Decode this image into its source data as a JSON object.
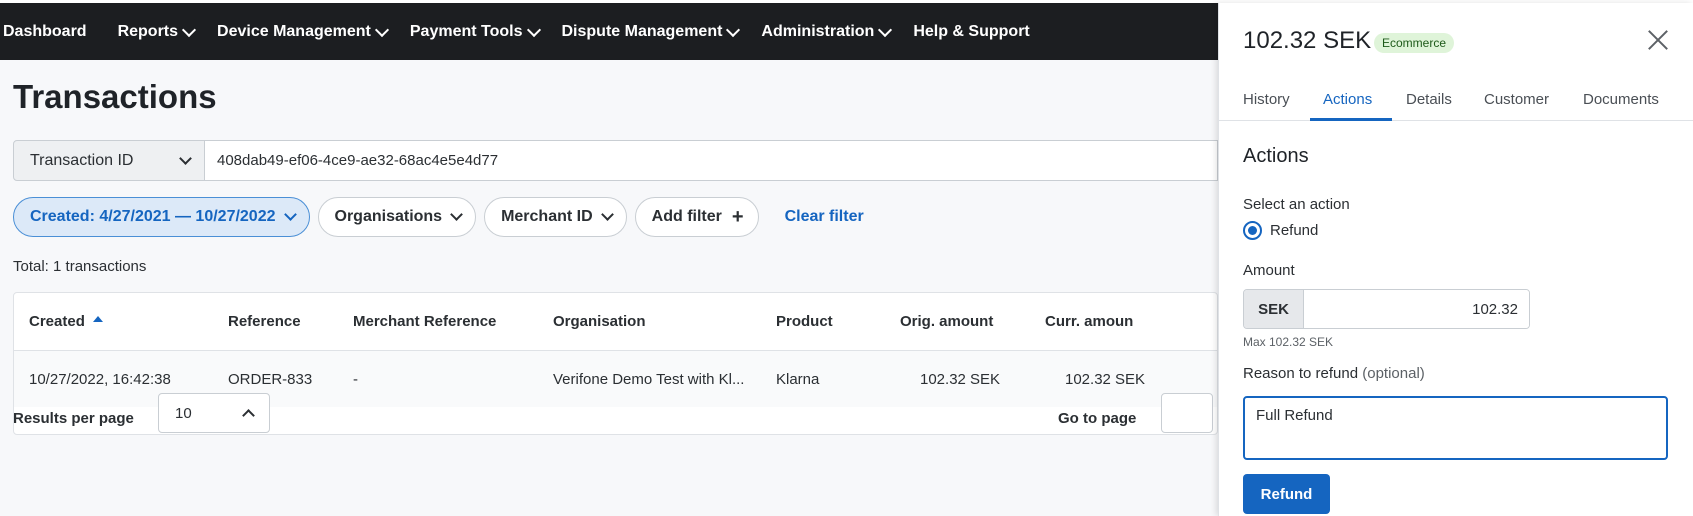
{
  "nav": {
    "items": [
      {
        "label": "Dashboard"
      },
      {
        "label": "Reports"
      },
      {
        "label": "Device Management"
      },
      {
        "label": "Payment Tools"
      },
      {
        "label": "Dispute Management"
      },
      {
        "label": "Administration"
      },
      {
        "label": "Help & Support"
      }
    ]
  },
  "page": {
    "title": "Transactions",
    "search_type": "Transaction ID",
    "search_value": "408dab49-ef06-4ce9-ae32-68ac4e5e4d77",
    "filters": {
      "created": "Created: 4/27/2021 — 10/27/2022",
      "organisations": "Organisations",
      "merchant_id": "Merchant ID",
      "add_filter": "Add filter",
      "clear_filter": "Clear filter"
    },
    "total": "Total: 1 transactions"
  },
  "table": {
    "columns": [
      "Created",
      "Reference",
      "Merchant Reference",
      "Organisation",
      "Product",
      "Orig. amount",
      "Curr. amoun"
    ],
    "rows": [
      [
        "10/27/2022, 16:42:38",
        "ORDER-833",
        "-",
        "Verifone Demo Test with Kl...",
        "Klarna",
        "102.32 SEK",
        "102.32 SEK"
      ]
    ]
  },
  "pagination": {
    "results_label": "Results per page",
    "per_page": "10",
    "goto_label": "Go to page",
    "goto_value": ""
  },
  "panel": {
    "amount": "102.32 SEK",
    "badge": "Ecommerce",
    "tabs": [
      "History",
      "Actions",
      "Details",
      "Customer",
      "Documents"
    ],
    "active_tab": "Actions",
    "section_title": "Actions",
    "select_label": "Select an action",
    "radio_option": "Refund",
    "amount_label": "Amount",
    "currency": "SEK",
    "amount_value": "102.32",
    "max_hint": "Max 102.32 SEK",
    "reason_label": "Reason to refund",
    "reason_optional": "(optional)",
    "reason_value": "Full Refund",
    "refund_button": "Refund"
  },
  "colors": {
    "nav_bg": "#1c1e21",
    "accent": "#1565c0",
    "badge_bg": "#dff4d9"
  }
}
